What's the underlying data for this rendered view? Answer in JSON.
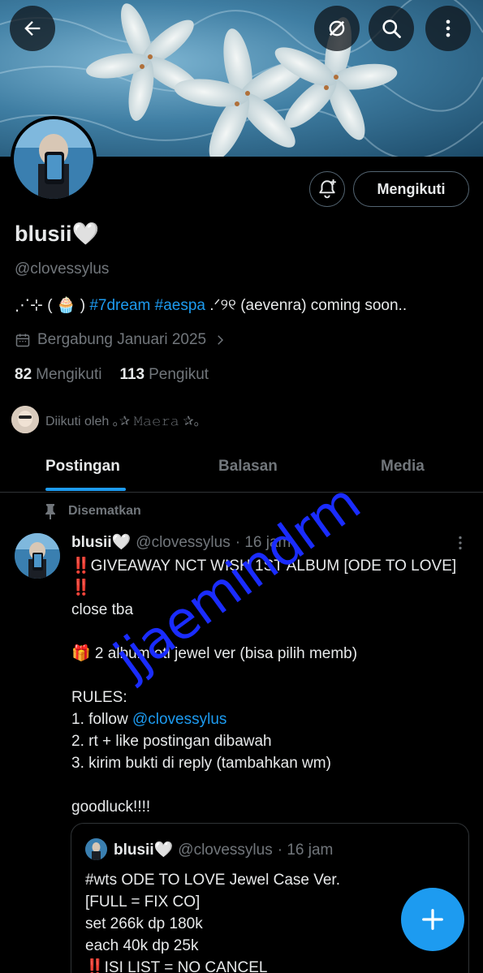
{
  "colors": {
    "accent": "#1d9bf0",
    "text": "#e7e9ea",
    "muted": "#71767b",
    "border": "#2f3336",
    "watermark": "#1a2cff"
  },
  "header": {
    "back_icon": "arrow-left-icon",
    "grok_icon": "grok-icon",
    "search_icon": "search-icon",
    "more_icon": "more-vertical-icon"
  },
  "profile": {
    "display_name": "blusii🤍",
    "handle": "@clovessylus",
    "bio_prefix": "⋰⊹ ( 🧁 )",
    "bio_tags": "#7dream #aespa",
    "bio_suffix": ".ᐟ୨୧ (aevenra) coming soon..",
    "joined": "Bergabung Januari 2025",
    "following_count": "82",
    "following_label": "Mengikuti",
    "followers_count": "113",
    "followers_label": "Pengikut",
    "followed_by": "Diikuti oleh ｡✰ 𝙼𝚊𝚎𝚛𝚊 ✰｡",
    "follow_button": "Mengikuti"
  },
  "tabs": [
    {
      "label": "Postingan",
      "active": true
    },
    {
      "label": "Balasan",
      "active": false
    },
    {
      "label": "Media",
      "active": false
    }
  ],
  "post": {
    "pinned_label": "Disematkan",
    "author": "blusii🤍",
    "handle": "@clovessylus",
    "time": "· 16 jam",
    "lines": [
      "‼️GIVEAWAY NCT WISH 1ST ALBUM [ODE TO LOVE]",
      "‼️",
      "close tba",
      "",
      "🎁 2 album otl jewel ver (bisa pilih memb)",
      "",
      "RULES:",
      "1. follow ",
      "2. rt + like postingan dibawah",
      "3. kirim bukti di reply (tambahkan wm)",
      "",
      "goodluck!!!!"
    ],
    "mention": "@clovessylus"
  },
  "quote": {
    "author": "blusii🤍",
    "handle": "@clovessylus",
    "time": "· 16 jam",
    "lines": [
      "#wts ODE TO LOVE Jewel Case Ver.",
      "[FULL = FIX CO]",
      "set 266k dp 180k",
      "each 40k dp 25k",
      "‼️ISI LIST = NO CANCEL"
    ]
  },
  "fab_icon": "plus-icon",
  "watermark": "jjaemindrm"
}
